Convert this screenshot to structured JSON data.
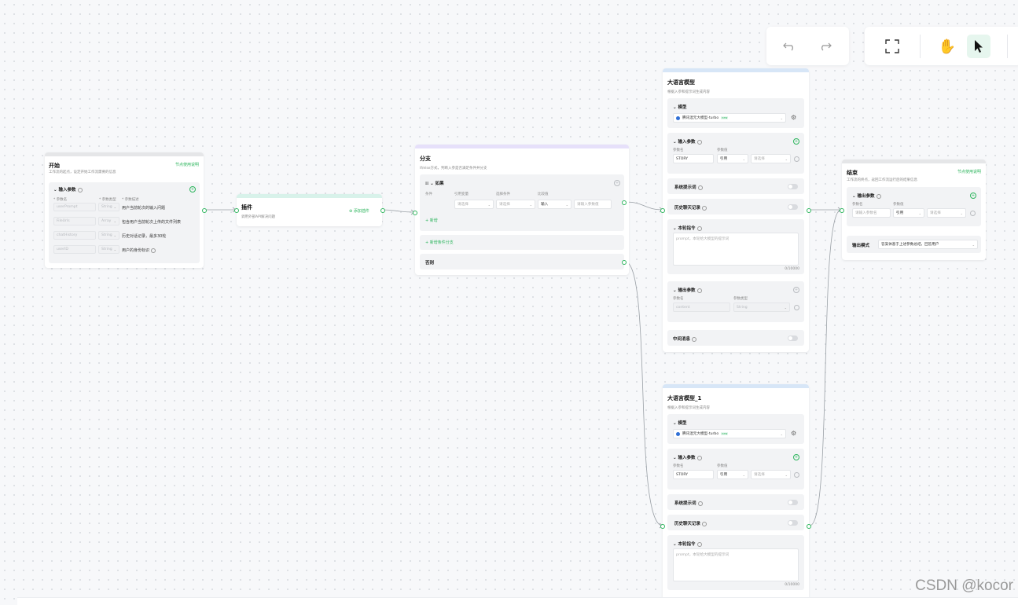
{
  "colors": {
    "accent": "#2db55d",
    "start_bar": "#e5e6e8",
    "plugin_bar": "#d8f2ea",
    "branch_bar": "#e6e0fa",
    "llm_bar": "#d7e6f7",
    "end_bar": "#e5e6e8"
  },
  "toolbar": {
    "undo_icon": "undo-icon",
    "redo_icon": "redo-icon",
    "fullscreen_icon": "fullscreen-icon",
    "hand_icon": "hand-icon",
    "pointer_icon": "pointer-icon"
  },
  "start": {
    "title": "开始",
    "desc": "工作流的起点，设定开始工作流需要的信息",
    "link": "节点使用说明",
    "section": "输入参数",
    "col_name": "* 参数名",
    "col_type": "* 参数类型",
    "col_desc": "* 参数描述",
    "params": [
      {
        "name": "userPrompt",
        "type": "String",
        "desc": "用户当前轮次的输入问题"
      },
      {
        "name": "FileUrls",
        "type": "Array",
        "desc": "包含用户当前轮次上传的文件列表"
      },
      {
        "name": "chatHistory",
        "type": "String",
        "desc": "历史对话记录，最多30轮"
      },
      {
        "name": "userID",
        "type": "String",
        "desc": "用户的身份标识"
      }
    ]
  },
  "plugin": {
    "title": "插件",
    "desc": "调用外部API解决问题",
    "add_label": "添加插件"
  },
  "branch": {
    "title": "分支",
    "desc": "If/else方式，判断入参是否满足条件并分支",
    "if_label": "如果",
    "cond_label": "条件",
    "col_ref": "引用变量",
    "col_cond": "选择条件",
    "col_cmp": "比较值",
    "ref_placeholder": "请选择",
    "cond_placeholder": "请选择",
    "cmp_value": "输入",
    "value_placeholder": "请输入参数值",
    "add_label": "新增",
    "add_branch_label": "新增条件分支",
    "else_label": "否则"
  },
  "llm1": {
    "title": "大语言模型",
    "desc": "根据入参和提示词生成内容",
    "model_section": "模型",
    "model_name": "腾讯混元大模型-turbo",
    "model_tag": "new",
    "input_section": "输入参数",
    "col_name": "参数名",
    "col_value": "参数值",
    "param_name": "STORY",
    "param_ref": "引用",
    "param_placeholder": "请选择",
    "system_prompt": "系统提示词",
    "history": "历史聊天记录",
    "instruction_section": "本轮指令",
    "instruction_placeholder": "prompt，本轮给大模型的提示词",
    "counter": "0/10000",
    "output_section": "输出参数",
    "out_col_name": "参数名",
    "out_col_type": "参数类型",
    "out_name": "content",
    "out_type": "String",
    "middle_msg": "中间消息"
  },
  "llm2": {
    "title": "大语言模型_1",
    "desc": "根据入参和提示词生成内容",
    "model_section": "模型",
    "model_name": "腾讯混元大模型-turbo",
    "model_tag": "new",
    "input_section": "输入参数",
    "col_name": "参数名",
    "col_value": "参数值",
    "param_name": "STORY",
    "param_ref": "引用",
    "param_placeholder": "请选择",
    "system_prompt": "系统提示词",
    "history": "历史聊天记录",
    "instruction_section": "本轮指令",
    "instruction_placeholder": "prompt，本轮给大模型的提示词",
    "counter": "0/10000"
  },
  "end": {
    "title": "结束",
    "desc": "工作流的终点，返回工作流运行后的结果信息",
    "link": "节点使用说明",
    "section": "输出参数",
    "col_name": "参数名",
    "col_value": "参数值",
    "name_placeholder": "请输入参数名",
    "param_ref": "引用",
    "param_placeholder": "请选择",
    "mode_label": "输出模式",
    "mode_value": "答案体基于上述参数总结，回答用户"
  },
  "watermark": "CSDN @kocor"
}
